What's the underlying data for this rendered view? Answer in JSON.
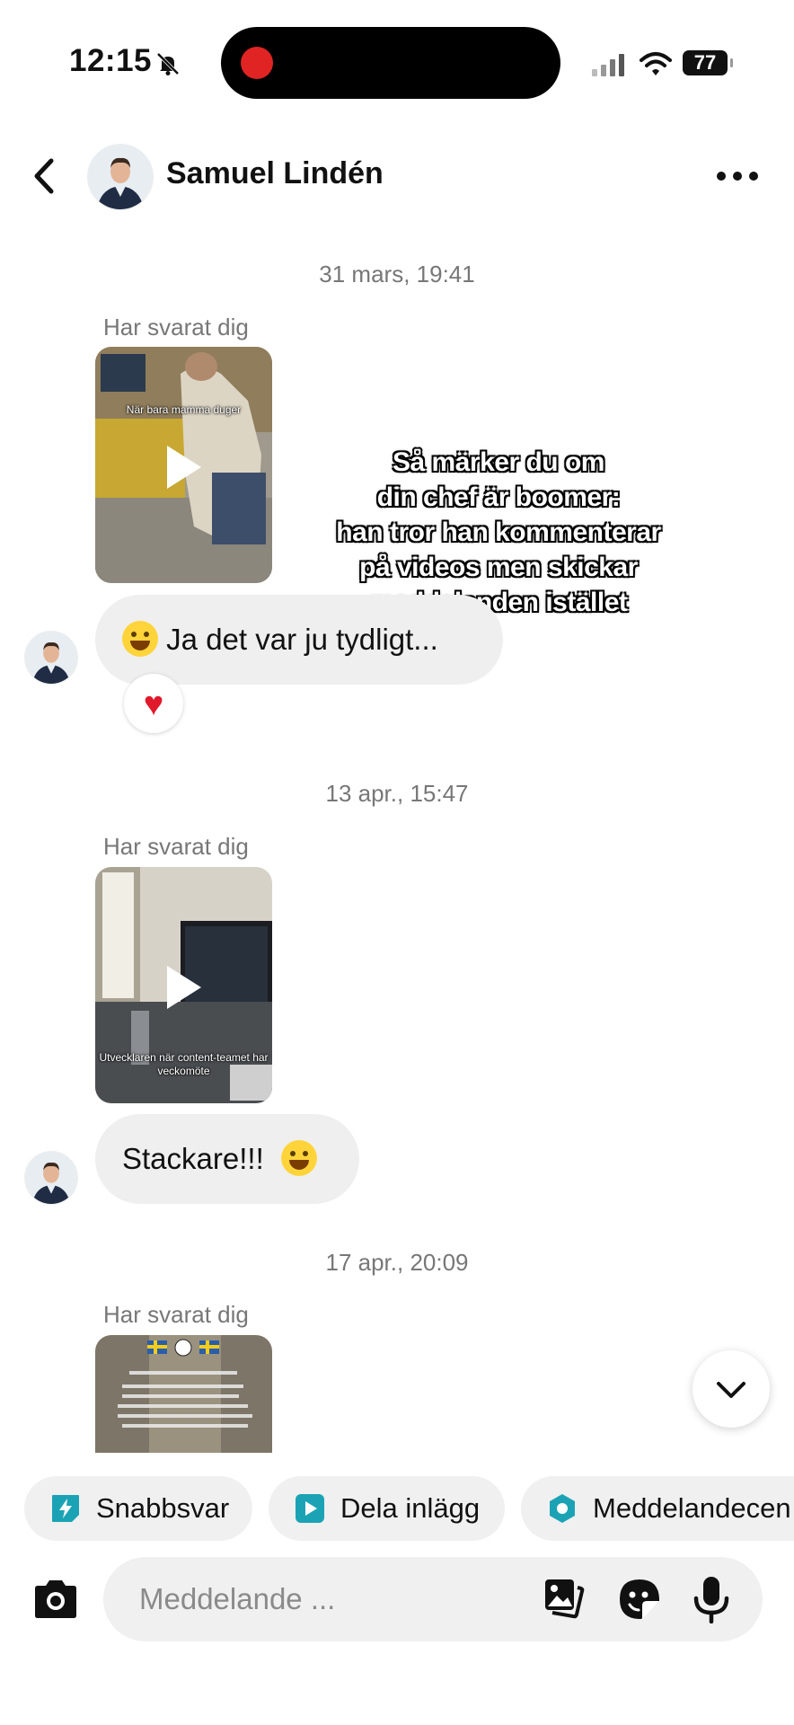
{
  "status_bar": {
    "time": "12:15",
    "battery": "77"
  },
  "header": {
    "contact_name": "Samuel Lindén"
  },
  "messages": [
    {
      "date": "31 mars, 19:41",
      "reply_label": "Har svarat dig",
      "video_caption": "När bara mamma duger",
      "bubble_text": "Ja det var ju tydligt...",
      "reaction": "♥"
    },
    {
      "date": "13 apr., 15:47",
      "reply_label": "Har svarat dig",
      "video_caption": "Utvecklaren när content-teamet har veckomöte",
      "bubble_text": "Stackare!!!"
    },
    {
      "date": "17 apr., 20:09",
      "reply_label": "Har svarat dig"
    }
  ],
  "overlay_text": "Så märker du om\ndin chef är boomer:\nhan tror han kommenterar\npå videos men skickar\nmeddelanden istället",
  "quick_actions": [
    {
      "label": "Snabbsvar",
      "icon": "lightning-icon"
    },
    {
      "label": "Dela inlägg",
      "icon": "play-square-icon"
    },
    {
      "label": "Meddelandecen",
      "icon": "hexagon-icon"
    }
  ],
  "composer": {
    "placeholder": "Meddelande ..."
  },
  "colors": {
    "accent_teal": "#1ba3b5",
    "bubble_gray": "#efefef",
    "heart_red": "#e0192b"
  }
}
